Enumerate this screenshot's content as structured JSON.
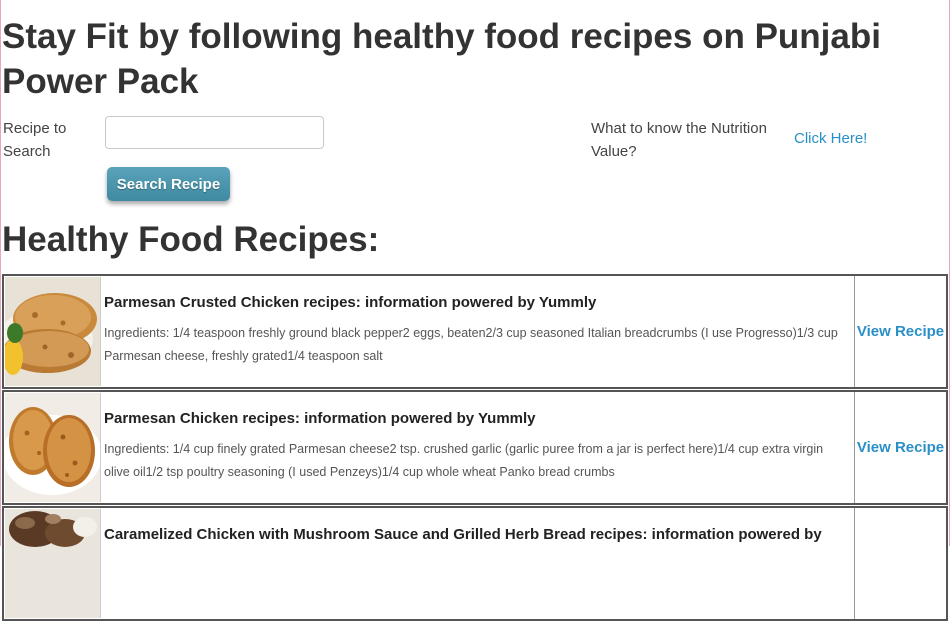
{
  "header": {
    "title": "Stay Fit by following healthy food recipes on Punjabi Power Pack"
  },
  "search": {
    "label": "Recipe to Search",
    "input_value": "",
    "button_label": "Search Recipe"
  },
  "nutrition": {
    "prompt": "What to know the Nutrition Value?",
    "link_label": "Click Here!"
  },
  "section": {
    "title": "Healthy Food Recipes:"
  },
  "recipes": [
    {
      "title": "Parmesan Crusted Chicken recipes: information powered by Yummly",
      "ingredients": "Ingredients: 1/4 teaspoon freshly ground black pepper2 eggs, beaten2/3 cup seasoned Italian breadcrumbs (I use Progresso)1/3 cup Parmesan cheese, freshly grated1/4 teaspoon salt",
      "action_label": "View Recipe",
      "image": "chicken-cutlet-photo"
    },
    {
      "title": "Parmesan Chicken recipes: information powered by Yummly",
      "ingredients": "Ingredients: 1/4 cup finely grated Parmesan cheese2 tsp. crushed garlic (garlic puree from a jar is perfect here)1/4 cup extra virgin olive oil1/2 tsp poultry seasoning (I used Penzeys)1/4 cup whole wheat Panko bread crumbs",
      "action_label": "View Recipe",
      "image": "breaded-chicken-photo"
    },
    {
      "title": "Caramelized Chicken with Mushroom Sauce and Grilled Herb Bread recipes: information powered by",
      "ingredients": "",
      "action_label": "",
      "image": "mushroom-chicken-photo"
    }
  ]
}
